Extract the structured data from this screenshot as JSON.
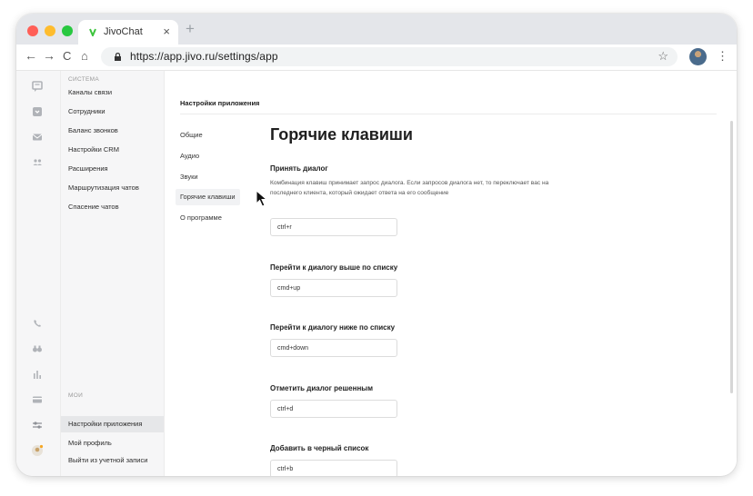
{
  "browser": {
    "tab_title": "JivoChat",
    "tab_close": "×",
    "new_tab": "+",
    "url": "https://app.jivo.ru/settings/app",
    "nav_back": "←",
    "nav_forward": "→",
    "nav_reload": "C",
    "nav_home": "⌂",
    "star": "☆",
    "menu": "⋮"
  },
  "sidebar": {
    "system_label": "СИСТЕМА",
    "system_items": [
      "Каналы связи",
      "Сотрудники",
      "Баланс звонков",
      "Настройки CRM",
      "Расширения",
      "Маршрутизация чатов",
      "Спасение чатов"
    ],
    "my_label": "МОИ",
    "my_items": [
      "Настройки приложения",
      "Мой профиль",
      "Выйти из учетной записи"
    ],
    "active_item": "Настройки приложения"
  },
  "settings": {
    "header": "Настройки приложения",
    "sub_items": [
      "Общие",
      "Аудио",
      "Звуки",
      "Горячие клавиши",
      "О программе"
    ],
    "active_sub_item": "Горячие клавиши"
  },
  "hotkeys": {
    "title": "Горячие клавиши",
    "sections": [
      {
        "title": "Принять диалог",
        "description": "Комбинация клавиш принимает запрос диалога. Если запросов диалога нет, то переключает вас на последнего клиента, который ожидает ответа на его сообщение",
        "value": "ctrl+r"
      },
      {
        "title": "Перейти к диалогу выше по списку",
        "value": "cmd+up"
      },
      {
        "title": "Перейти к диалогу ниже по списку",
        "value": "cmd+down"
      },
      {
        "title": "Отметить диалог решенным",
        "value": "ctrl+d"
      },
      {
        "title": "Добавить в черный список",
        "value": "ctrl+b"
      }
    ]
  },
  "colors": {
    "brand_green": "#3cc43c",
    "sidebar_bg": "#f6f6f7",
    "active_bg": "#e6e7e9"
  }
}
